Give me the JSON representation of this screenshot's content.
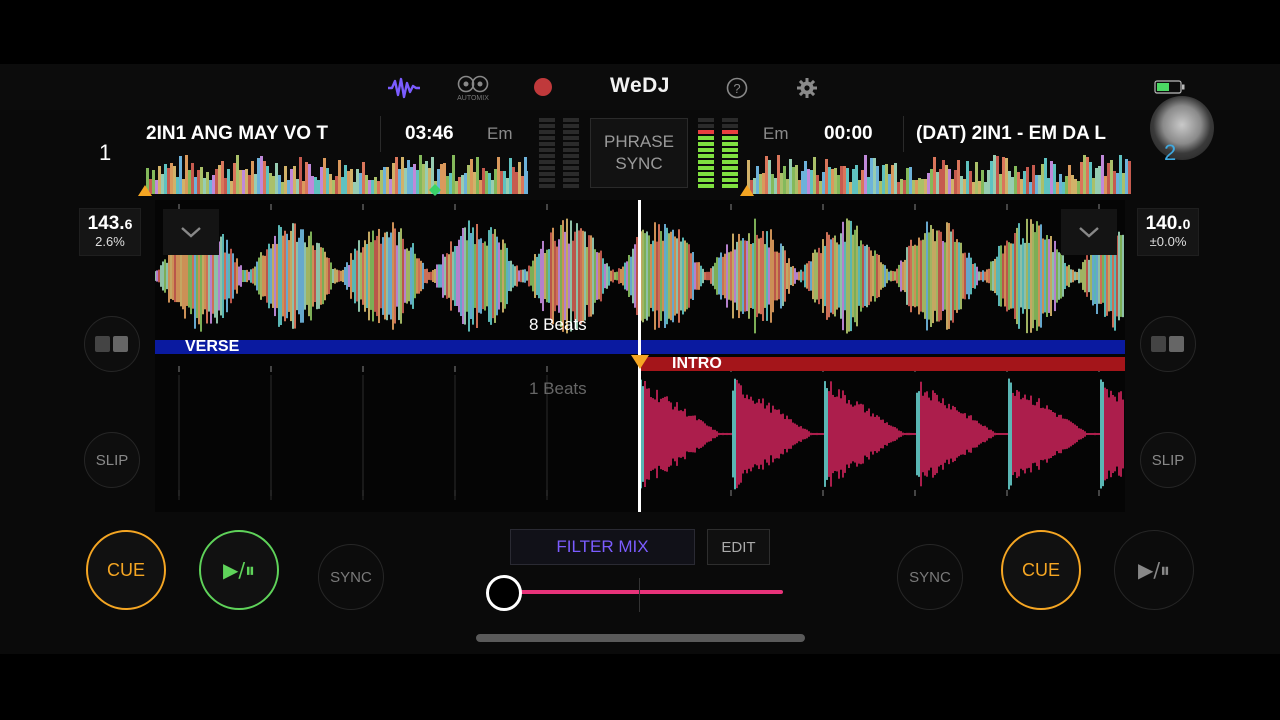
{
  "app": {
    "title": "WeDJ"
  },
  "topbar": {
    "automix_label": "AUTOMIX",
    "icons": [
      "waveform-icon",
      "automix-icon",
      "record-icon",
      "help-icon",
      "gear-icon",
      "battery-icon"
    ]
  },
  "deck1": {
    "number": "1",
    "title": "2IN1 ANG MAY VO T",
    "time": "03:46",
    "key": "Em",
    "bpm_main": "143.",
    "bpm_decimal": "6",
    "pitch": "2.6%",
    "slip_label": "SLIP",
    "cue_label": "CUE",
    "play_label": "▶/⏸",
    "sync_label": "SYNC",
    "section_label": "VERSE",
    "beats_label": "8 Beats",
    "color": "#e8336f"
  },
  "deck2": {
    "number": "2",
    "title": "(DAT) 2IN1 - EM DA L",
    "time": "00:00",
    "key": "Em",
    "bpm_main": "140.",
    "bpm_decimal": "0",
    "pitch": "±0.0%",
    "slip_label": "SLIP",
    "cue_label": "CUE",
    "play_label": "▶/⏸",
    "sync_label": "SYNC",
    "section_label": "INTRO",
    "beats_label": "1 Beats",
    "color": "#3fa9e0"
  },
  "center": {
    "phrase_sync_line1": "PHRASE",
    "phrase_sync_line2": "SYNC",
    "filter_mix_label": "FILTER MIX",
    "edit_label": "EDIT"
  },
  "colors": {
    "accent_purple": "#7b5cff",
    "cue_orange": "#f5a623",
    "play_green": "#5fd35a",
    "crossfader_pink": "#e8337a",
    "verse_blue": "#0a1aa0",
    "intro_red": "#a4151a"
  }
}
